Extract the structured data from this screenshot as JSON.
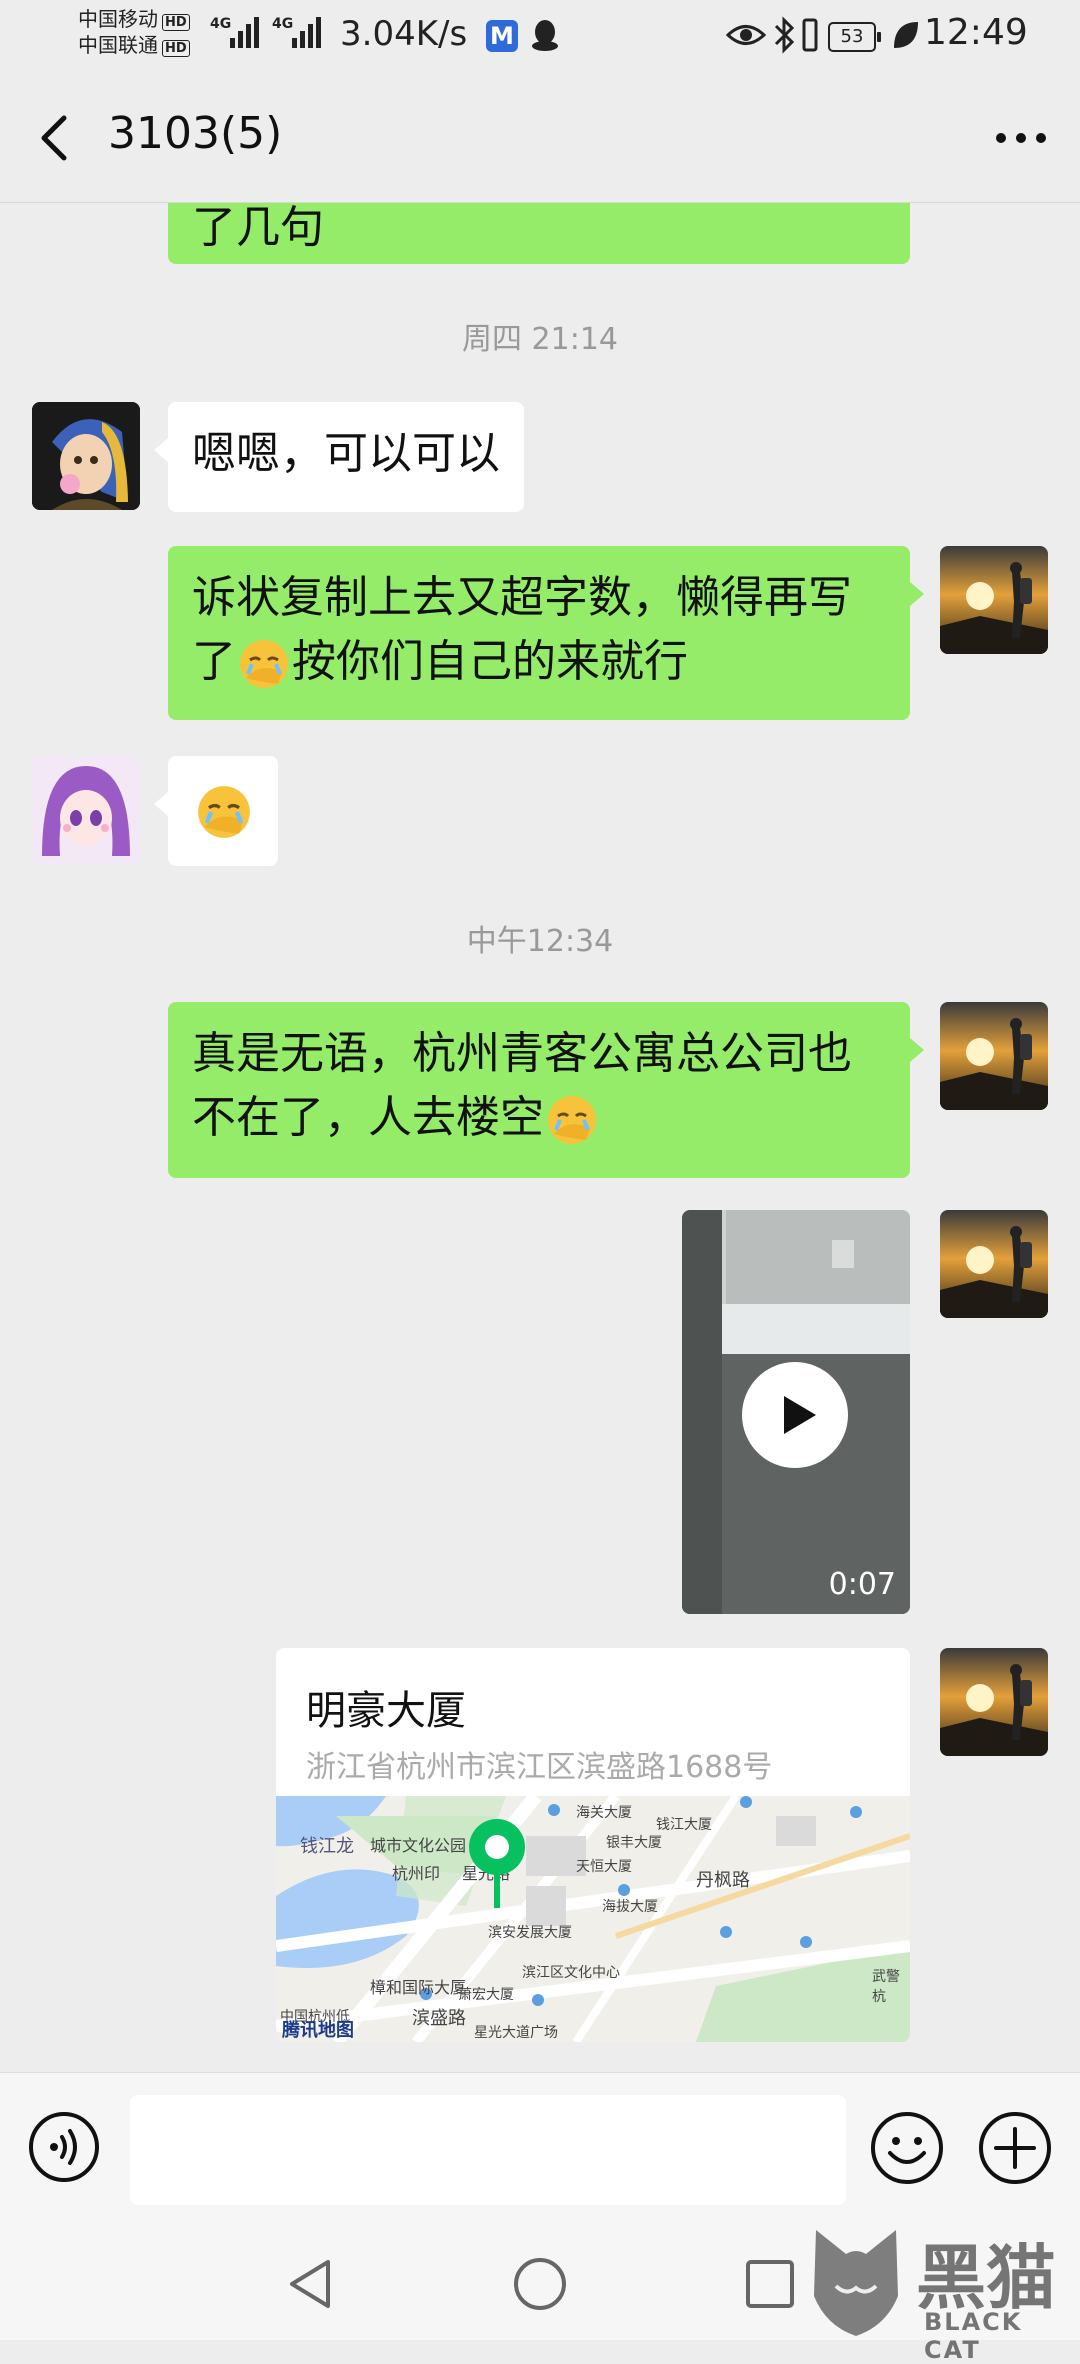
{
  "status_bar": {
    "carrier_1": "中国移动",
    "carrier_2": "中国联通",
    "hd_label": "HD",
    "network_type": "4G",
    "speed": "3.04K/s",
    "m_app_label": "M",
    "battery": "53",
    "time": "12:49"
  },
  "header": {
    "title": "3103(5)"
  },
  "messages": {
    "partial_text": "了几句",
    "time_1": "周四 21:14",
    "msg_1": "嗯嗯，可以可以",
    "msg_2_line1": "诉状复制上去又超字数，懒得再写",
    "msg_2_line2_a": "了",
    "msg_2_line2_b": "按你们自己的来就行",
    "time_2": "中午12:34",
    "msg_3_line1": "真是无语，杭州青客公寓总公司也",
    "msg_3_line2": "不在了，人去楼空",
    "video_duration": "0:07",
    "location": {
      "name": "明豪大厦",
      "address": "浙江省杭州市滨江区滨盛路1688号",
      "map_provider": "腾讯地图",
      "map_labels": [
        "钱江龙",
        "城市文化公园",
        "杭州印",
        "星光路",
        "滨安发展大厦",
        "滨江区文化中心",
        "樟和国际大厦",
        "萧宏大厦",
        "滨盛路",
        "丹枫路",
        "海关大厦",
        "银丰大厦",
        "天恒大厦",
        "海拔大厦",
        "钱江大厦",
        "中国杭州低",
        "星光大道广场",
        "武警杭"
      ]
    }
  },
  "input": {
    "placeholder": ""
  },
  "watermark": {
    "cn": "黑猫",
    "en": "BLACK CAT"
  },
  "colors": {
    "bubble_green": "#95ec69",
    "background": "#ededed",
    "location_pin": "#07c160"
  }
}
